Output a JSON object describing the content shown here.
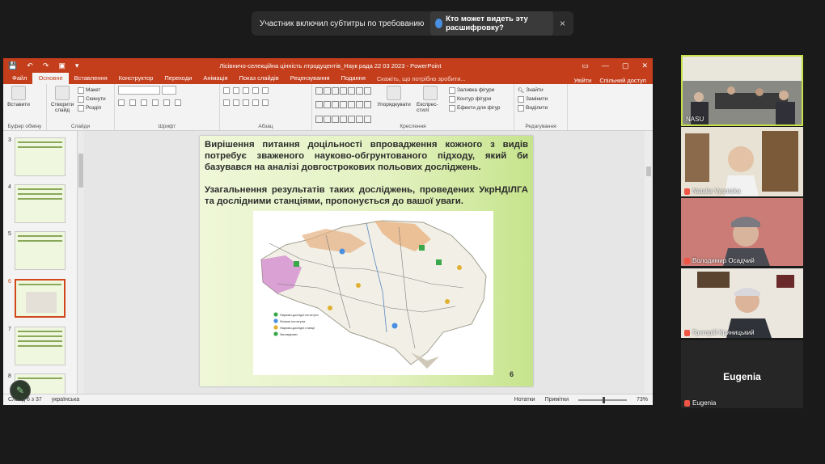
{
  "caption_banner": {
    "message": "Участник включил субтитры по требованию",
    "who_button": "Кто может видеть эту расшифровку?",
    "close": "×"
  },
  "ppt": {
    "title": "Лісівничо-селекційна цінність лтродуцентів_Наук рада 22 03 2023 - PowerPoint",
    "qat": [
      "💾",
      "↶",
      "↷",
      "▣",
      "▾"
    ],
    "window_buttons": [
      "▭",
      "—",
      "▢",
      "✕"
    ],
    "tabs": [
      "Файл",
      "Основне",
      "Вставлення",
      "Конструктор",
      "Переходи",
      "Анімація",
      "Показ слайдів",
      "Рецензування",
      "Подання"
    ],
    "active_tab": "Основне",
    "tell_me": "Скажіть, що потрібно зробити...",
    "sign_in": "Увійти",
    "share": "Спільний доступ",
    "ribbon": {
      "clipboard": {
        "paste": "Вставити",
        "label": "Буфер обміну"
      },
      "slides": {
        "new_slide": "Створити слайд",
        "layout": "Макет",
        "reset": "Скинути",
        "section": "Розділ",
        "label": "Слайди"
      },
      "font": {
        "label": "Шрифт"
      },
      "paragraph": {
        "label": "Абзац"
      },
      "drawing": {
        "arrange": "Упорядкувати",
        "quick_styles": "Експрес-стилі",
        "fill": "Заливка фігури",
        "outline": "Контур фігури",
        "effects": "Ефекти для фігур",
        "label": "Креслення"
      },
      "editing": {
        "find": "Знайти",
        "replace": "Замінити",
        "select": "Виділити",
        "label": "Редагування"
      }
    },
    "thumbnails": [
      {
        "num": "3"
      },
      {
        "num": "4"
      },
      {
        "num": "5"
      },
      {
        "num": "6",
        "selected": true
      },
      {
        "num": "7"
      },
      {
        "num": "8"
      }
    ],
    "slide": {
      "paragraph1": "Вирішення питання доцільності впровадження кожного з видів потребує зваженого науково-обгрунтованого підходу, який би базувався на аналізі довгострокових польових досліджень.",
      "paragraph2": "Узагальнення результатів таких досліджень, проведених УкрНДІЛГА та дослідними станціями, пропонується до вашої уваги.",
      "legend": [
        "Науково-дослідні інститути",
        "Філіали інститутів",
        "Науково-дослідні станції",
        "Заповідники"
      ],
      "page_number": "6"
    },
    "status": {
      "slide_info": "Слайд 6 з 37",
      "language": "українська",
      "notes": "Нотатки",
      "comments": "Примітки",
      "zoom": "73%"
    }
  },
  "participants": [
    {
      "name": "NASU"
    },
    {
      "name": "Natalia Vysotska"
    },
    {
      "name": "Володимир Осадчий"
    },
    {
      "name": "Григорій Криницький"
    },
    {
      "name": "Eugenia",
      "avatar_text": "Eugenia"
    }
  ]
}
